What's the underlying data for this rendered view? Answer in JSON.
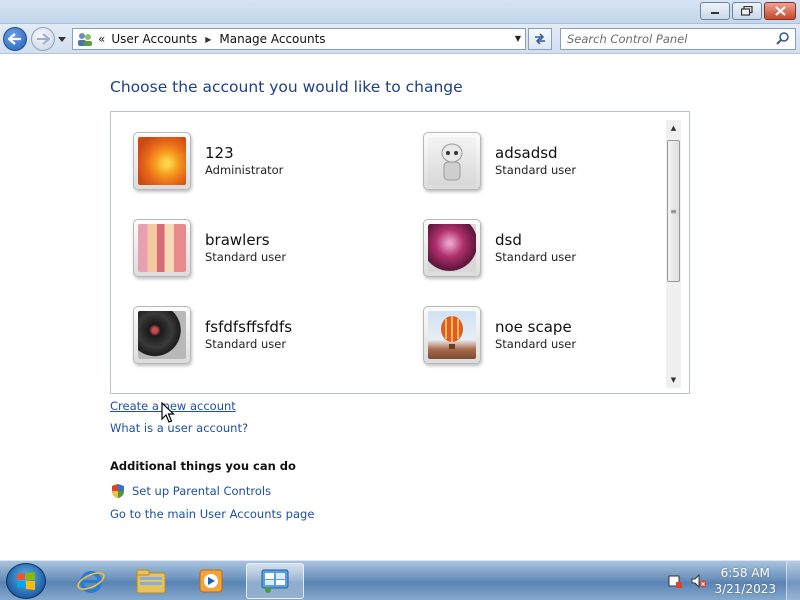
{
  "titlebar": {
    "minimize_icon": "minimize-icon",
    "maximize_icon": "restore-icon",
    "close_icon": "close-icon"
  },
  "nav": {
    "back_icon": "back-arrow-icon",
    "forward_icon": "forward-arrow-icon",
    "breadcrumb_prefix": "«",
    "breadcrumbs": [
      "User Accounts",
      "Manage Accounts"
    ],
    "refresh_icon": "refresh-icon",
    "search_placeholder": "Search Control Panel"
  },
  "main": {
    "title": "Choose the account you would like to change",
    "accounts": [
      {
        "name": "123",
        "role": "Administrator",
        "picture": "flower"
      },
      {
        "name": "adsadsd",
        "role": "Standard user",
        "picture": "robot"
      },
      {
        "name": "brawlers",
        "role": "Standard user",
        "picture": "fabric"
      },
      {
        "name": "dsd",
        "role": "Standard user",
        "picture": "ball"
      },
      {
        "name": "fsfdfsffsfdfs",
        "role": "Standard user",
        "picture": "turntable"
      },
      {
        "name": "noe scape",
        "role": "Standard user",
        "picture": "balloon"
      }
    ],
    "create_link": "Create a new account",
    "what_is_link": "What is a user account?",
    "additional_title": "Additional things you can do",
    "parental_controls": "Set up Parental Controls",
    "main_page_link": "Go to the main User Accounts page"
  },
  "taskbar": {
    "items": [
      "start-orb",
      "internet-explorer",
      "windows-explorer",
      "media-player",
      "control-panel"
    ],
    "time": "6:58 AM",
    "date": "3/21/2023"
  },
  "colors": {
    "title_blue": "#1e3f8a",
    "link_blue": "#1e50a2",
    "taskbar": "#6c92bd"
  }
}
